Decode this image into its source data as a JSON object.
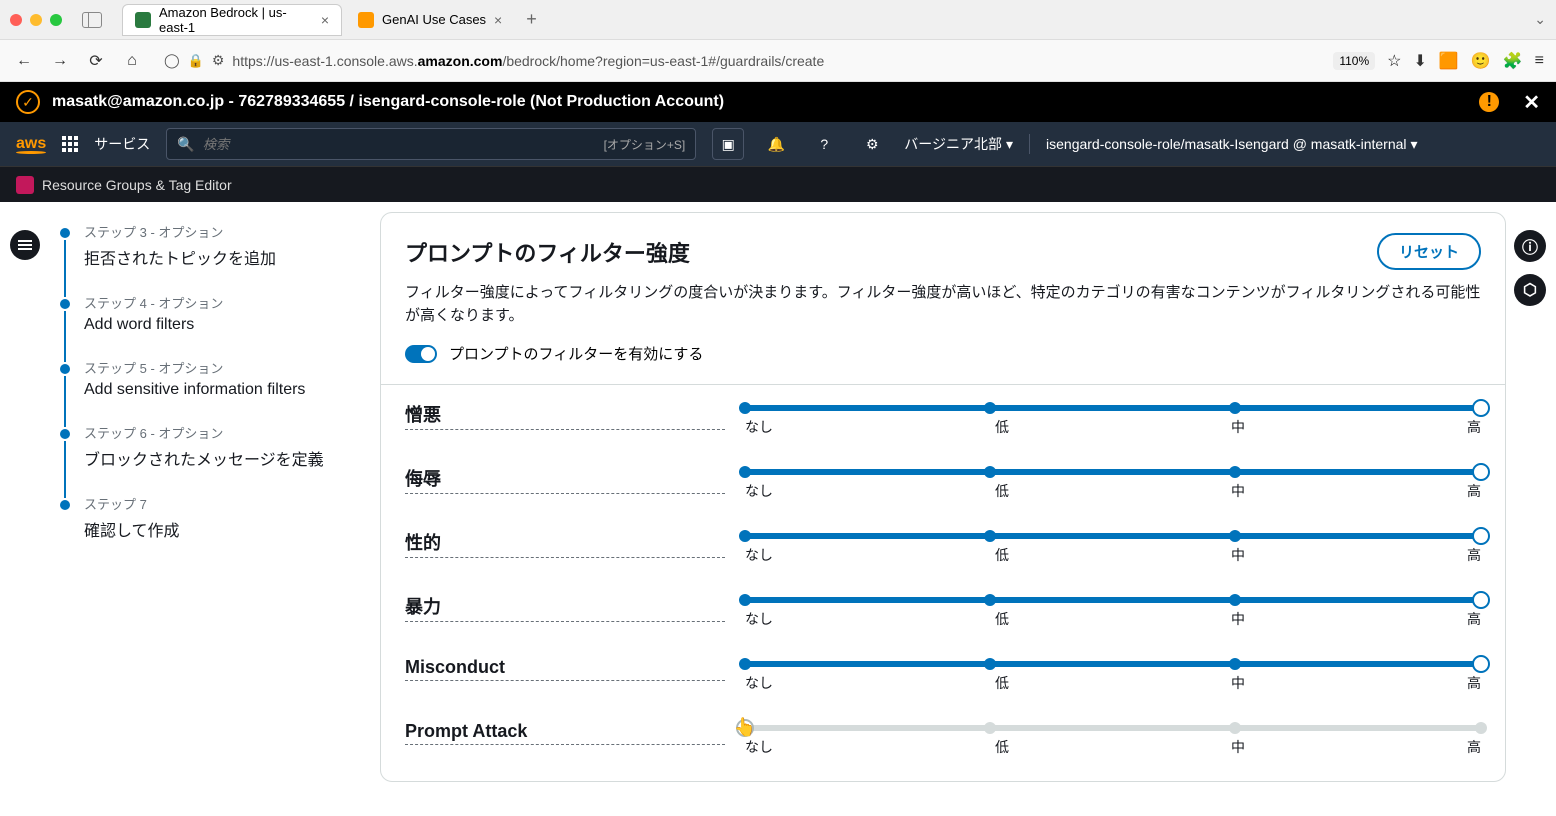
{
  "browser": {
    "tabs": [
      {
        "title": "Amazon Bedrock | us-east-1",
        "active": true
      },
      {
        "title": "GenAI Use Cases",
        "active": false
      }
    ],
    "url_prefix": "https://us-east-1.console.aws.",
    "url_domain": "amazon.com",
    "url_path": "/bedrock/home?region=us-east-1#/guardrails/create",
    "zoom": "110%"
  },
  "account_bar": {
    "text": "masatk@amazon.co.jp - 762789334655 / isengard-console-role (Not Production Account)"
  },
  "aws_nav": {
    "services": "サービス",
    "search_placeholder": "検索",
    "search_shortcut": "[オプション+S]",
    "region": "バージニア北部",
    "role": "isengard-console-role/masatk-Isengard @ masatk-internal"
  },
  "rg_bar": "Resource Groups & Tag Editor",
  "steps": [
    {
      "label": "ステップ 3 - オプション",
      "title": "拒否されたトピックを追加"
    },
    {
      "label": "ステップ 4 - オプション",
      "title": "Add word filters"
    },
    {
      "label": "ステップ 5 - オプション",
      "title": "Add sensitive information filters"
    },
    {
      "label": "ステップ 6 - オプション",
      "title": "ブロックされたメッセージを定義"
    },
    {
      "label": "ステップ 7",
      "title": "確認して作成"
    }
  ],
  "panel": {
    "title": "プロンプトのフィルター強度",
    "reset": "リセット",
    "description": "フィルター強度によってフィルタリングの度合いが決まります。フィルター強度が高いほど、特定のカテゴリの有害なコンテンツがフィルタリングされる可能性が高くなります。",
    "toggle_label": "プロンプトのフィルターを有効にする"
  },
  "slider_labels": {
    "none": "なし",
    "low": "低",
    "mid": "中",
    "high": "高"
  },
  "filters": [
    {
      "name": "憎悪",
      "value": 3
    },
    {
      "name": "侮辱",
      "value": 3
    },
    {
      "name": "性的",
      "value": 3
    },
    {
      "name": "暴力",
      "value": 3
    },
    {
      "name": "Misconduct",
      "value": 3
    },
    {
      "name": "Prompt Attack",
      "value": 0
    }
  ]
}
